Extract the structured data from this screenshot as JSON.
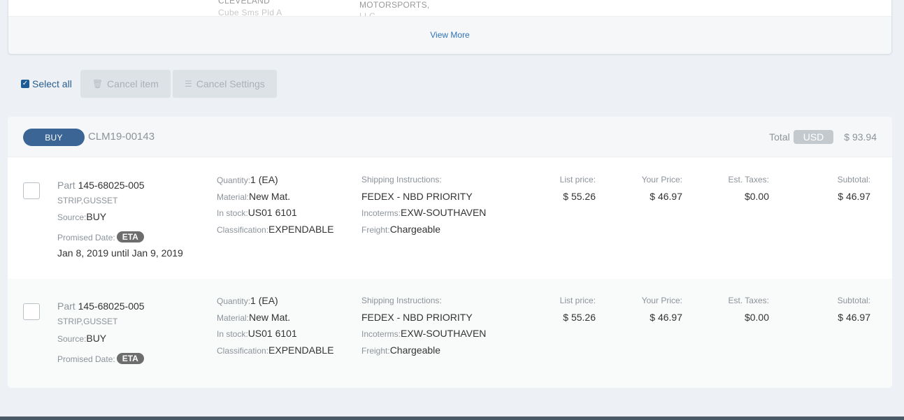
{
  "prev_card": {
    "cell1": "CLEVELAND",
    "cell1b": "Cube Sms Pld A",
    "cell2": "MOTORSPORTS,",
    "cell2b": "LLC",
    "view_more": "View More"
  },
  "toolbar": {
    "select_all": "Select all",
    "cancel_item": "Cancel item",
    "cancel_settings": "Cancel Settings"
  },
  "order": {
    "type_badge": "BUY",
    "order_id": "CLM19-00143",
    "total_label": "Total",
    "currency": "USD",
    "total_value": "$ 93.94"
  },
  "labels": {
    "part": "Part",
    "source": "Source:",
    "promised_date": "Promised Date:",
    "eta": "ETA",
    "quantity": "Quantity:",
    "material": "Material:",
    "in_stock": "In stock:",
    "classification": "Classification:",
    "shipping_instructions": "Shipping Instructions:",
    "incoterms": "Incoterms:",
    "freight": "Freight:",
    "list_price": "List price:",
    "your_price": "Your Price:",
    "est_taxes": "Est. Taxes:",
    "subtotal": "Subtotal:"
  },
  "items": [
    {
      "part_number": "145-68025-005",
      "description": "STRIP,GUSSET",
      "source": "BUY",
      "promised_range": "Jan 8, 2019 until Jan 9, 2019",
      "quantity": "1 (EA)",
      "material": "New Mat.",
      "in_stock": "US01 6101",
      "classification": "EXPENDABLE",
      "shipping": "FEDEX - NBD PRIORITY",
      "incoterms": "EXW-SOUTHAVEN",
      "freight": "Chargeable",
      "list_price": "$ 55.26",
      "your_price": "$ 46.97",
      "est_taxes": "$0.00",
      "subtotal": "$ 46.97"
    },
    {
      "part_number": "145-68025-005",
      "description": "STRIP,GUSSET",
      "source": "BUY",
      "quantity": "1 (EA)",
      "material": "New Mat.",
      "in_stock": "US01 6101",
      "classification": "EXPENDABLE",
      "shipping": "FEDEX - NBD PRIORITY",
      "incoterms": "EXW-SOUTHAVEN",
      "freight": "Chargeable",
      "list_price": "$ 55.26",
      "your_price": "$ 46.97",
      "est_taxes": "$0.00",
      "subtotal": "$ 46.97"
    }
  ],
  "colors": {
    "page_bg": "#edf1f5",
    "badge_buy": "#3a6594",
    "link": "#2e73b8",
    "eta_badge": "#6d6d6d"
  }
}
